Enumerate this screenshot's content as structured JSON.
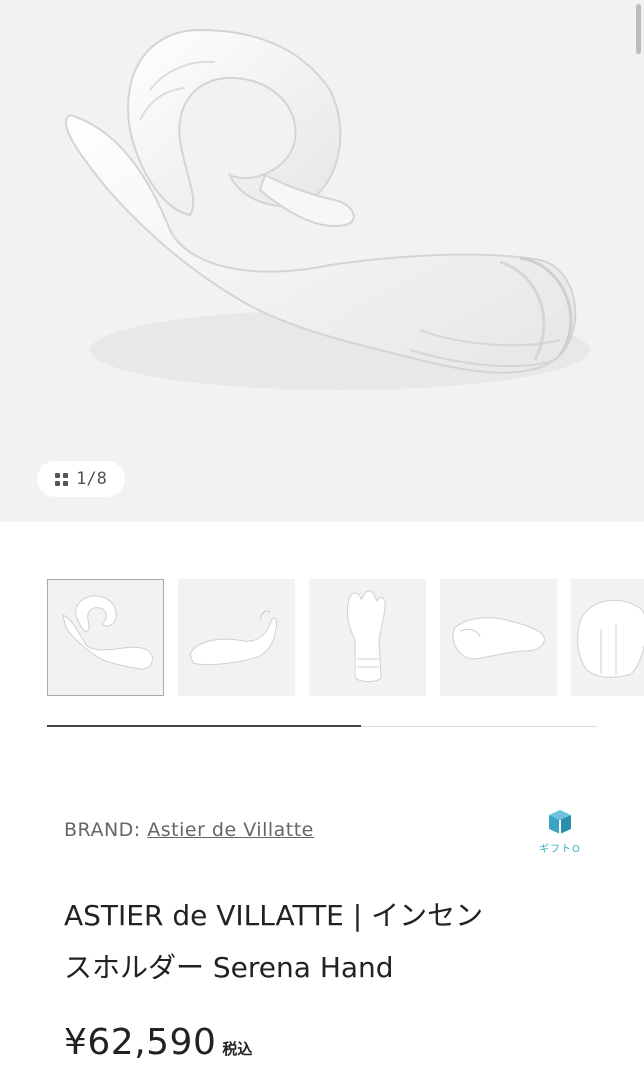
{
  "gallery": {
    "counter": "1/8",
    "counter_icon": "grid-icon",
    "thumbnails": [
      "thumb-1",
      "thumb-2",
      "thumb-3",
      "thumb-4",
      "thumb-5"
    ],
    "active_index": 0,
    "progress": 0.57
  },
  "product": {
    "brand_label": "BRAND:",
    "brand_name": "Astier de Villatte",
    "gift_label": "ギフトO",
    "gift_icon": "gift-box-icon",
    "title_line1": "ASTIER de VILLATTE | インセン",
    "title_line2": "スホルダー Serena Hand",
    "price": "¥62,590",
    "tax_label": "税込"
  },
  "colors": {
    "hero_bg": "#f2f2f3",
    "gift_accent": "#3aa6c6"
  }
}
